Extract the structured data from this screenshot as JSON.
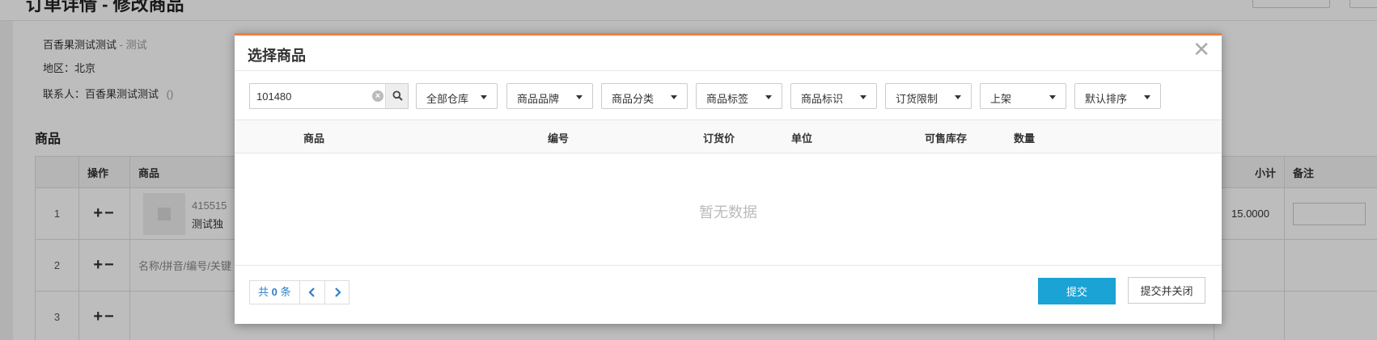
{
  "page": {
    "title": "订单详情 - 修改商品",
    "customer": {
      "name": "百香果测试测试",
      "name_suffix": " - 测试",
      "region_label": "地区：",
      "region": "北京",
      "contact_label": "联系人：",
      "contact": "百香果测试测试",
      "contact_phone": "()"
    },
    "section_title": "商品",
    "table": {
      "headers": [
        "",
        "操作",
        "商品",
        "小计",
        "备注"
      ],
      "rows": [
        {
          "index": "1",
          "ops": "+−",
          "code": "415515",
          "name": "测试独",
          "subtotal": "15.0000"
        },
        {
          "index": "2",
          "ops": "+−",
          "placeholder": "名称/拼音/编号/关键"
        },
        {
          "index": "3",
          "ops": "+−"
        }
      ]
    }
  },
  "modal": {
    "title": "选择商品",
    "close_icon": "close-icon",
    "search": {
      "value": "101480",
      "placeholder": ""
    },
    "filters": [
      "全部仓库",
      "商品品牌",
      "商品分类",
      "商品标签",
      "商品标识",
      "订货限制",
      "上架",
      "默认排序"
    ],
    "columns": [
      "商品",
      "编号",
      "订货价",
      "单位",
      "可售库存",
      "数量"
    ],
    "empty_text": "暂无数据",
    "pager": {
      "prefix": "共",
      "count": "0",
      "suffix": "条"
    },
    "buttons": {
      "submit": "提交",
      "submit_close": "提交并关闭"
    },
    "colors": {
      "accent_top": "#f07f3c",
      "primary": "#1aa3d4"
    }
  }
}
